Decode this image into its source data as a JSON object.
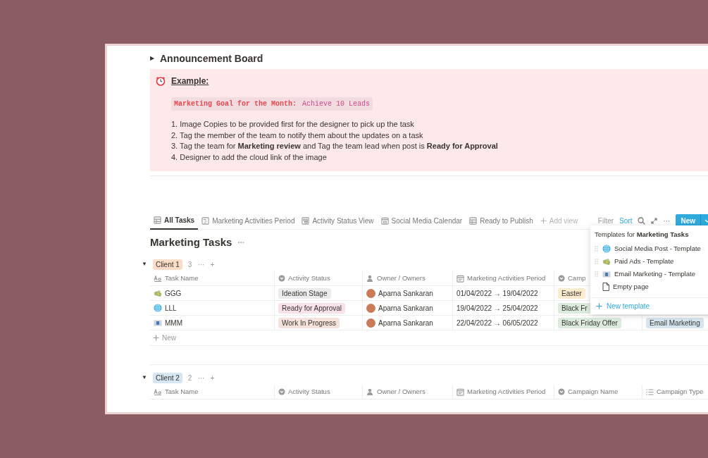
{
  "announcement": {
    "toggle": "▶",
    "title": "Announcement Board"
  },
  "callout": {
    "heading": "Example:",
    "goal_label": "Marketing Goal for the Month:",
    "goal_value": "Achieve 10 Leads",
    "steps": [
      "1. Image Copies to be provided first for the designer to pick up the task",
      "2. Tag the member of the team to notify them about the updates on a task",
      "3. Tag the team for **Marketing review** and Tag the team lead when post is **Ready for Approval**",
      "4. Designer to add the cloud link of the image"
    ]
  },
  "views": {
    "tabs": [
      {
        "label": "All Tasks",
        "kind": "table",
        "selected": true
      },
      {
        "label": "Marketing Activities Period",
        "kind": "timeline",
        "selected": false
      },
      {
        "label": "Activity Status View",
        "kind": "board",
        "selected": false
      },
      {
        "label": "Social Media Calendar",
        "kind": "calendar",
        "selected": false
      },
      {
        "label": "Ready to Publish",
        "kind": "table",
        "selected": false
      }
    ],
    "add_view": "Add view"
  },
  "toolbar": {
    "filter": {
      "label": "Filter",
      "active": false
    },
    "sort": {
      "label": "Sort",
      "active": true
    },
    "new_button": "New"
  },
  "database": {
    "title": "Marketing Tasks",
    "more": "···",
    "groups": [
      {
        "toggle": "▼",
        "label": "Client 1",
        "color": "#fbdcc7",
        "count": "3",
        "more": "···",
        "add": "+",
        "columns": [
          {
            "label": "Task Name",
            "kind": "text"
          },
          {
            "label": "Activity Status",
            "kind": "select"
          },
          {
            "label": "Owner / Owners",
            "kind": "person"
          },
          {
            "label": "Marketing Activities Period",
            "kind": "date"
          },
          {
            "label": "Camp",
            "kind": "select"
          }
        ],
        "rows": [
          {
            "task": {
              "name": "GGG",
              "kind": "money"
            },
            "status": {
              "label": "Ideation Stage",
              "color": "#ebeced"
            },
            "owner": "Aparna Sankaran",
            "period": "01/04/2022 → 19/04/2022",
            "campaign": {
              "label": "Easter",
              "color": "#fbecd0"
            }
          },
          {
            "task": {
              "name": "LLL",
              "kind": "globe"
            },
            "status": {
              "label": "Ready for Approval",
              "color": "#f8e1ea"
            },
            "owner": "Aparna Sankaran",
            "period": "19/04/2022 → 25/04/2022",
            "campaign": {
              "label": "Black Fr",
              "color": "#dcecdc"
            }
          },
          {
            "task": {
              "name": "MMM",
              "kind": "mail"
            },
            "status": {
              "label": "Work In Progress",
              "color": "#f6e2dc"
            },
            "owner": "Aparna Sankaran",
            "period": "22/04/2022 → 06/05/2022",
            "campaign": {
              "label": "Black Friday Offer",
              "color": "#dcecdc"
            },
            "type": {
              "label": "Email Marketing",
              "color": "#d6e5f0"
            }
          }
        ],
        "new_row": "New"
      },
      {
        "toggle": "▼",
        "label": "Client 2",
        "color": "#d6e6f2",
        "count": "2",
        "more": "···",
        "add": "+",
        "columns": [
          {
            "label": "Task Name",
            "kind": "text"
          },
          {
            "label": "Activity Status",
            "kind": "select"
          },
          {
            "label": "Owner / Owners",
            "kind": "person"
          },
          {
            "label": "Marketing Activities Period",
            "kind": "date"
          },
          {
            "label": "Campaign Name",
            "kind": "select"
          },
          {
            "label": "Campaign Type",
            "kind": "list"
          }
        ]
      }
    ]
  },
  "template_menu": {
    "heading": "Templates for **Marketing Tasks**",
    "items": [
      {
        "label": "Social Media Post - Template",
        "kind": "globe",
        "draggable": true
      },
      {
        "label": "Paid Ads - Template",
        "kind": "money",
        "draggable": true
      },
      {
        "label": "Email Marketing - Template",
        "kind": "mail",
        "draggable": true
      },
      {
        "label": "Empty page",
        "kind": "page",
        "draggable": false
      }
    ],
    "new_template": "New template"
  }
}
